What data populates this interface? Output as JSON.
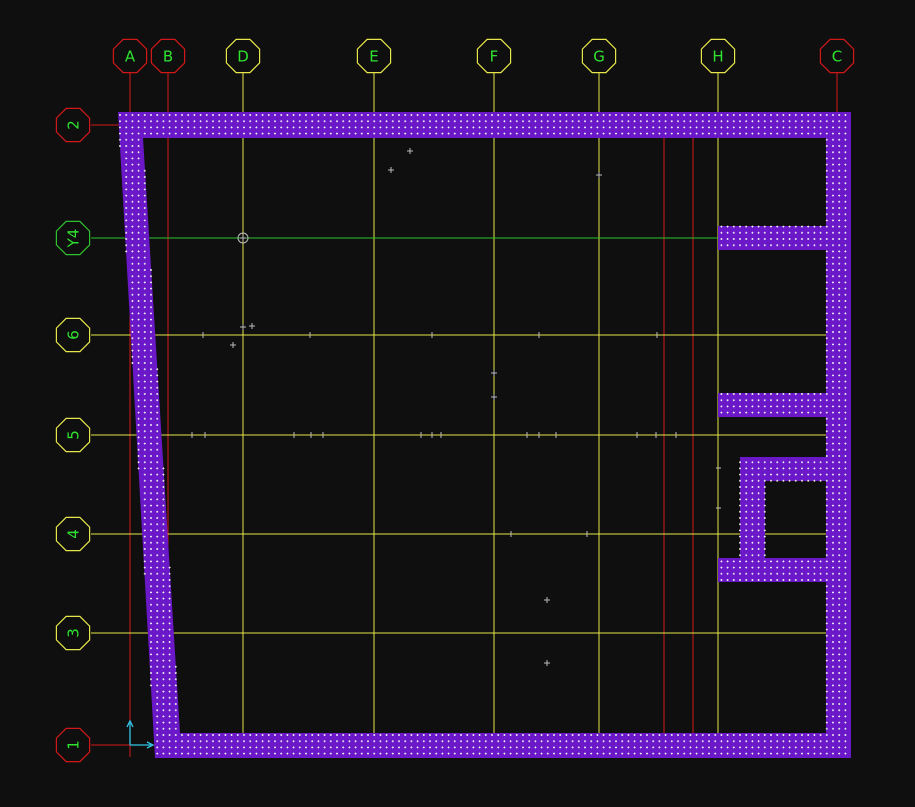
{
  "title": "",
  "colors": {
    "background": "#0f0f0f",
    "slab_fill": "#6a18c8",
    "mesh_dot": "#f0f0f0",
    "grid_yellow": "#e6e64a",
    "grid_red": "#d01818",
    "grid_green": "#2fc02f",
    "label_text": "#2fe22f",
    "bubble_yellow": "#e6e64a",
    "bubble_red": "#d01818",
    "bubble_green": "#2fc02f"
  },
  "vertical_axes": [
    {
      "label": "A",
      "type": "red"
    },
    {
      "label": "B",
      "type": "red"
    },
    {
      "label": "D",
      "type": "yellow"
    },
    {
      "label": "E",
      "type": "yellow"
    },
    {
      "label": "F",
      "type": "yellow"
    },
    {
      "label": "G",
      "type": "yellow"
    },
    {
      "label": "H",
      "type": "yellow"
    },
    {
      "label": "C",
      "type": "red"
    }
  ],
  "horizontal_axes": [
    {
      "label": "2",
      "type": "red"
    },
    {
      "label": "Y4",
      "type": "green"
    },
    {
      "label": "6",
      "type": "yellow"
    },
    {
      "label": "5",
      "type": "yellow"
    },
    {
      "label": "4",
      "type": "yellow"
    },
    {
      "label": "3",
      "type": "yellow"
    },
    {
      "label": "1",
      "type": "red"
    }
  ],
  "coordinate_icon": {
    "y_label": "Y",
    "x_label": "X"
  }
}
